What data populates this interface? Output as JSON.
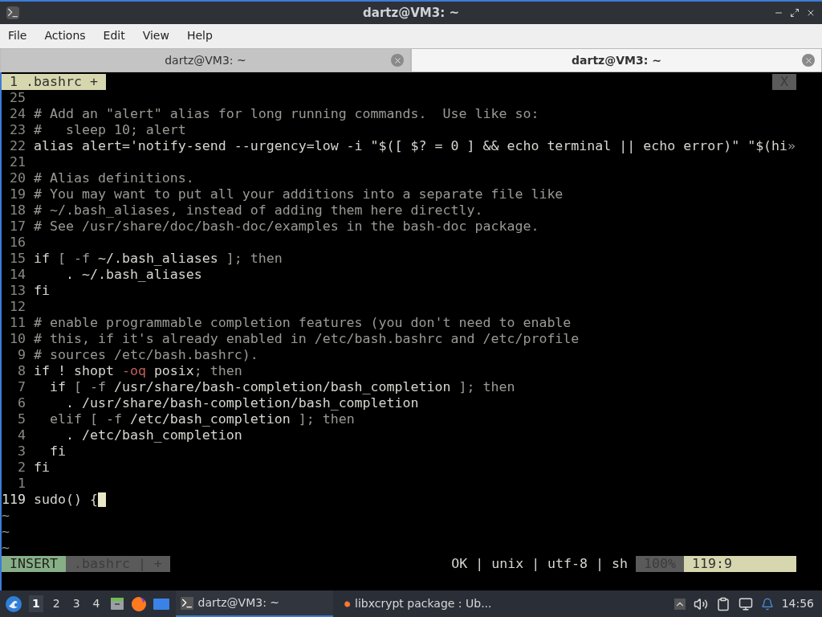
{
  "window": {
    "title": "dartz@VM3: ~"
  },
  "menu": [
    "File",
    "Actions",
    "Edit",
    "View",
    "Help"
  ],
  "tabs": [
    {
      "label": "dartz@VM3: ~",
      "selected": false
    },
    {
      "label": "dartz@VM3: ~",
      "selected": true
    }
  ],
  "editor": {
    "buffer_tab": "1 .bashrc +",
    "close_label": "X",
    "lines": [
      {
        "number": "25",
        "current": false
      },
      {
        "number": "24",
        "current": false,
        "segments": [
          {
            "text": "# Add an \"alert\" alias for long running commands.  Use like so:",
            "kind": "dim"
          }
        ]
      },
      {
        "number": "23",
        "current": false,
        "segments": [
          {
            "text": "#   sleep 10; alert",
            "kind": "dim"
          }
        ]
      },
      {
        "number": "22",
        "current": false,
        "segments": [
          {
            "text": "alias alert='notify-send --urgency=low -i \"$([ $? = 0 ] && echo terminal || echo error)\" \"$(hi",
            "kind": "normal"
          },
          {
            "text": "»",
            "kind": "dim"
          }
        ]
      },
      {
        "number": "21",
        "current": false
      },
      {
        "number": "20",
        "current": false,
        "segments": [
          {
            "text": "# Alias definitions.",
            "kind": "dim"
          }
        ]
      },
      {
        "number": "19",
        "current": false,
        "segments": [
          {
            "text": "# You may want to put all your additions into a separate file like",
            "kind": "dim"
          }
        ]
      },
      {
        "number": "18",
        "current": false,
        "segments": [
          {
            "text": "# ~/.bash_aliases, instead of adding them here directly.",
            "kind": "dim"
          }
        ]
      },
      {
        "number": "17",
        "current": false,
        "segments": [
          {
            "text": "# See /usr/share/doc/bash-doc/examples in the bash-doc package.",
            "kind": "dim"
          }
        ]
      },
      {
        "number": "16",
        "current": false
      },
      {
        "number": "15",
        "current": false,
        "segments": [
          {
            "text": "if ",
            "kind": "normal"
          },
          {
            "text": "[ -f ",
            "kind": "dim"
          },
          {
            "text": "~/.bash_aliases ",
            "kind": "normal"
          },
          {
            "text": "]; then",
            "kind": "dim"
          }
        ]
      },
      {
        "number": "14",
        "current": false,
        "segments": [
          {
            "text": "    . ~/.bash_aliases",
            "kind": "normal"
          }
        ]
      },
      {
        "number": "13",
        "current": false,
        "segments": [
          {
            "text": "fi",
            "kind": "normal"
          }
        ]
      },
      {
        "number": "12",
        "current": false
      },
      {
        "number": "11",
        "current": false,
        "segments": [
          {
            "text": "# enable programmable completion features (you don't need to enable",
            "kind": "dim"
          }
        ]
      },
      {
        "number": "10",
        "current": false,
        "segments": [
          {
            "text": "# this, if it's already enabled in /etc/bash.bashrc and /etc/profile",
            "kind": "dim"
          }
        ]
      },
      {
        "number": "9",
        "current": false,
        "segments": [
          {
            "text": "# sources /etc/bash.bashrc).",
            "kind": "dim"
          }
        ]
      },
      {
        "number": "8",
        "current": false,
        "segments": [
          {
            "text": "if ! shopt ",
            "kind": "normal"
          },
          {
            "text": "-oq",
            "kind": "red"
          },
          {
            "text": " posix",
            "kind": "normal"
          },
          {
            "text": "; then",
            "kind": "dim"
          }
        ]
      },
      {
        "number": "7",
        "current": false,
        "segments": [
          {
            "text": "  if ",
            "kind": "normal"
          },
          {
            "text": "[ -f ",
            "kind": "dim"
          },
          {
            "text": "/usr/share/bash-completion/bash_completion ",
            "kind": "normal"
          },
          {
            "text": "]; then",
            "kind": "dim"
          }
        ]
      },
      {
        "number": "6",
        "current": false,
        "segments": [
          {
            "text": "    . /usr/share/bash-completion/bash_completion",
            "kind": "normal"
          }
        ]
      },
      {
        "number": "5",
        "current": false,
        "segments": [
          {
            "text": "  elif [ -f ",
            "kind": "dim"
          },
          {
            "text": "/etc/bash_completion ",
            "kind": "normal"
          },
          {
            "text": "]; then",
            "kind": "dim"
          }
        ]
      },
      {
        "number": "4",
        "current": false,
        "segments": [
          {
            "text": "    . /etc/bash_completion",
            "kind": "normal"
          }
        ]
      },
      {
        "number": "3",
        "current": false,
        "segments": [
          {
            "text": "  fi",
            "kind": "normal"
          }
        ]
      },
      {
        "number": "2",
        "current": false,
        "segments": [
          {
            "text": "fi",
            "kind": "normal"
          }
        ]
      },
      {
        "number": "1",
        "current": false
      },
      {
        "number": "119",
        "current": true,
        "cursor": true,
        "segments": [
          {
            "text": "sudo() {",
            "kind": "normal"
          }
        ]
      }
    ],
    "tildes": [
      "~",
      "~",
      "~"
    ],
    "status": {
      "mode": "INSERT",
      "file": ".bashrc | +",
      "info": "OK | unix | utf-8 | sh",
      "percent": "100%",
      "position": "119:9"
    }
  },
  "taskbar": {
    "workspaces": [
      {
        "label": "1",
        "selected": true
      },
      {
        "label": "2",
        "selected": false
      },
      {
        "label": "3",
        "selected": false
      },
      {
        "label": "4",
        "selected": false
      }
    ],
    "tasks": [
      {
        "label": "dartz@VM3: ~",
        "kind": "terminal",
        "selected": true
      },
      {
        "label": "libxcrypt package : Ub...",
        "kind": "browser",
        "selected": false
      }
    ],
    "clock": "14:56"
  }
}
